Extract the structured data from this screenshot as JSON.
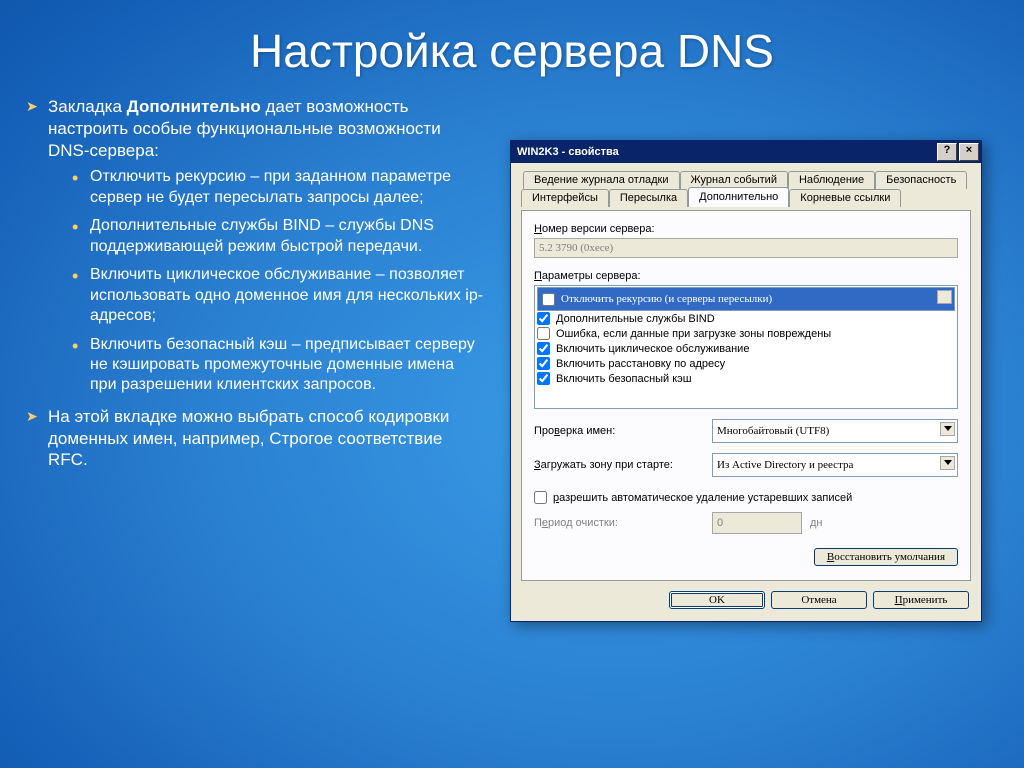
{
  "title": "Настройка сервера DNS",
  "text": {
    "top1_prefix": "Закладка ",
    "top1_bold": "Дополнительно",
    "top1_suffix": " дает возможность настроить особые функциональные возможности DNS-сервера:",
    "sub1": "Отключить рекурсию – при заданном параметре сервер не будет пересылать запросы далее;",
    "sub2": "Дополнительные службы BIND – службы DNS поддерживающей режим быстрой передачи.",
    "sub3": "Включить циклическое обслуживание – позволяет использовать одно доменное имя для нескольких ip-адресов;",
    "sub4": "Включить безопасный кэш – предписывает серверу не кэшировать промежуточные доменные имена при разрешении клиентских запросов.",
    "top2": "На этой вкладке можно выбрать способ кодировки доменных имен, например, Строгое соответствие RFC."
  },
  "dialog": {
    "title": "WIN2K3 - свойства",
    "help": "?",
    "close": "×",
    "tabs_row1": [
      "Ведение журнала отладки",
      "Журнал событий",
      "Наблюдение",
      "Безопасность"
    ],
    "tabs_row2": [
      "Интерфейсы",
      "Пересылка",
      "Дополнительно",
      "Корневые ссылки"
    ],
    "active_tab": 2,
    "version_label_u": "Н",
    "version_label": "омер версии сервера:",
    "version_value": "5.2 3790 (0xece)",
    "params_label_u": "П",
    "params_label": "араметры сервера:",
    "params": [
      {
        "checked": false,
        "selected": true,
        "label": "Отключить рекурсию (и серверы пересылки)"
      },
      {
        "checked": true,
        "selected": false,
        "label": "Дополнительные службы BIND"
      },
      {
        "checked": false,
        "selected": false,
        "label": "Ошибка, если данные при загрузке зоны повреждены"
      },
      {
        "checked": true,
        "selected": false,
        "label": "Включить циклическое обслуживание"
      },
      {
        "checked": true,
        "selected": false,
        "label": "Включить расстановку по адресу"
      },
      {
        "checked": true,
        "selected": false,
        "label": "Включить безопасный кэш"
      }
    ],
    "name_check_label_u": "в",
    "name_check_label_pre": "Про",
    "name_check_label_post": "ерка имен:",
    "name_check_value": "Многобайтовый (UTF8)",
    "load_zone_label_u": "З",
    "load_zone_label": "агружать зону при старте:",
    "load_zone_value": "Из Active Directory и реестра",
    "auto_delete_u": "р",
    "auto_delete": "азрешить автоматическое удаление устаревших записей",
    "period_label_u": "е",
    "period_label_pre": "П",
    "period_label_post": "риод очистки:",
    "period_value": "0",
    "period_unit": "дн",
    "restore_defaults_u": "В",
    "restore_defaults": "осстановить умолчания",
    "ok": "OK",
    "cancel": "Отмена",
    "apply_u": "П",
    "apply": "рименить"
  }
}
